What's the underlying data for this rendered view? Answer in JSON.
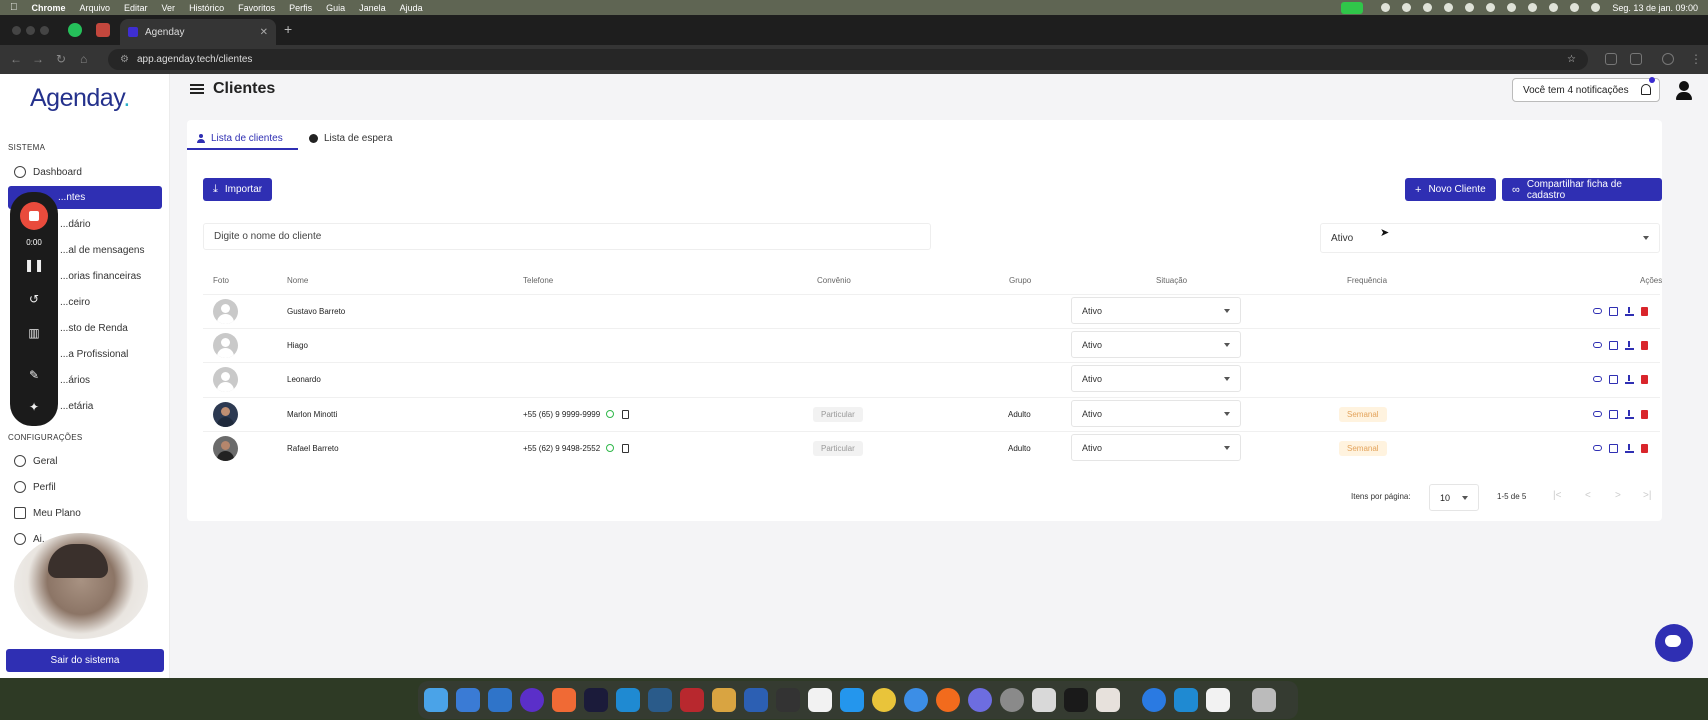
{
  "menubar": {
    "app": "Chrome",
    "items": [
      "Arquivo",
      "Editar",
      "Ver",
      "Histórico",
      "Favoritos",
      "Perfis",
      "Guia",
      "Janela",
      "Ajuda"
    ],
    "clock": "Seg. 13 de jan.  09:00"
  },
  "browser": {
    "tab_title": "Agenday",
    "url": "app.agenday.tech/clientes"
  },
  "sidebar": {
    "logo": "Agenday",
    "logo_dot": ".",
    "section_sistema": "SISTEMA",
    "items_sistema": [
      {
        "label": "Dashboard"
      },
      {
        "label": "...ntes"
      },
      {
        "label": "...dário"
      },
      {
        "label": "...al de mensagens"
      },
      {
        "label": "...orias financeiras"
      },
      {
        "label": "...ceiro"
      },
      {
        "label": "...sto de Renda"
      },
      {
        "label": "...a Profissional"
      },
      {
        "label": "...ários"
      },
      {
        "label": "...etária"
      }
    ],
    "section_config": "CONFIGURAÇÕES",
    "items_config": [
      {
        "label": "Geral"
      },
      {
        "label": "Perfil"
      },
      {
        "label": "Meu Plano"
      },
      {
        "label": "Ai..."
      }
    ],
    "logout": "Sair do sistema"
  },
  "recorder": {
    "time": "0:00"
  },
  "header": {
    "title": "Clientes",
    "notifications": "Você tem 4 notificações"
  },
  "tabs": {
    "clientes": "Lista de clientes",
    "espera": "Lista de espera"
  },
  "actions": {
    "import": "Importar",
    "new_client": "Novo Cliente",
    "share": "Compartilhar ficha de cadastro"
  },
  "filters": {
    "search_placeholder": "Digite o nome do cliente",
    "status": "Ativo"
  },
  "table": {
    "columns": [
      "Foto",
      "Nome",
      "Telefone",
      "Convênio",
      "Grupo",
      "Situação",
      "Frequência",
      "Ações"
    ],
    "rows": [
      {
        "name": "Gustavo Barreto",
        "phone": "",
        "convenio": "",
        "grupo": "",
        "situacao": "Ativo",
        "frequencia": ""
      },
      {
        "name": "Hiago",
        "phone": "",
        "convenio": "",
        "grupo": "",
        "situacao": "Ativo",
        "frequencia": ""
      },
      {
        "name": "Leonardo",
        "phone": "",
        "convenio": "",
        "grupo": "",
        "situacao": "Ativo",
        "frequencia": ""
      },
      {
        "name": "Marlon Minotti",
        "phone": "+55 (65) 9 9999-9999",
        "convenio": "Particular",
        "grupo": "Adulto",
        "situacao": "Ativo",
        "frequencia": "Semanal"
      },
      {
        "name": "Rafael Barreto",
        "phone": "+55 (62) 9 9498-2552",
        "convenio": "Particular",
        "grupo": "Adulto",
        "situacao": "Ativo",
        "frequencia": "Semanal"
      }
    ]
  },
  "pagination": {
    "label": "Itens por página:",
    "size": "10",
    "range": "1-5 de 5"
  },
  "colors": {
    "primary": "#2f2fb3",
    "danger": "#d9252b",
    "whatsapp": "#30b84a",
    "recorder_stop": "#e94b3c"
  }
}
